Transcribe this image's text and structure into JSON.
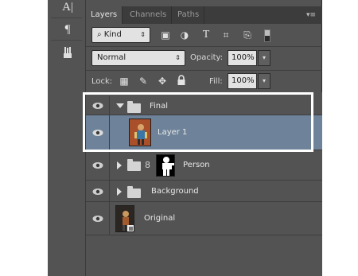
{
  "tools": [
    {
      "name": "type-tool-icon",
      "glyph": "A|"
    },
    {
      "name": "paragraph-icon",
      "glyph": "¶"
    },
    {
      "name": "brush-preset-icon",
      "glyph": "ᴪ"
    }
  ],
  "tabs": [
    {
      "label": "Layers",
      "active": true
    },
    {
      "label": "Channels",
      "active": false
    },
    {
      "label": "Paths",
      "active": false
    }
  ],
  "panel_menu_icon": "▾≡",
  "filter": {
    "kind_label": "Kind",
    "kind_arrow": "⇕",
    "icons": [
      "image-filter-icon",
      "adjustment-filter-icon",
      "type-filter-icon",
      "shape-filter-icon",
      "smart-object-filter-icon"
    ],
    "glyphs": [
      "▣",
      "◑",
      "T",
      "⌗",
      "⎘"
    ]
  },
  "blend": {
    "mode": "Normal",
    "arrow": "⇕",
    "opacity_label": "Opacity:",
    "opacity_value": "100%",
    "drop_arrow": "▾"
  },
  "lock": {
    "label": "Lock:",
    "glyphs": [
      "▦",
      "✎",
      "✥",
      "🔒"
    ],
    "fill_label": "Fill:",
    "fill_value": "100%",
    "drop_arrow": "▾"
  },
  "layers": [
    {
      "name": "Final",
      "type": "group",
      "expanded": true,
      "selected": false
    },
    {
      "name": "Layer 1",
      "type": "pixel",
      "selected": true
    },
    {
      "name": "Person",
      "type": "group-with-mask",
      "expanded": false,
      "selected": false
    },
    {
      "name": "Background",
      "type": "group",
      "expanded": false,
      "selected": false
    },
    {
      "name": "Original",
      "type": "smart-object",
      "selected": false
    }
  ],
  "colors": {
    "panel_bg": "#535353",
    "selected_row": "#6e8399",
    "highlight": "#ffffff"
  }
}
